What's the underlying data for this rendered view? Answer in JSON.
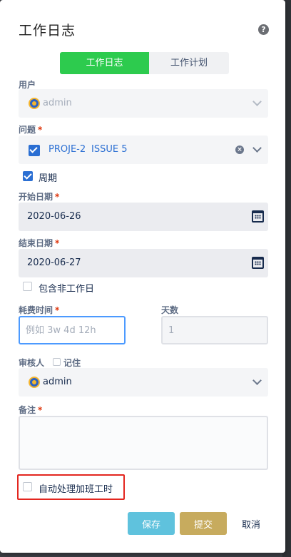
{
  "dialog": {
    "title": "工作日志",
    "help_icon": "?"
  },
  "tabs": [
    {
      "label": "工作日志",
      "active": true
    },
    {
      "label": "工作计划",
      "active": false
    }
  ],
  "user": {
    "label": "用户",
    "value": "admin"
  },
  "issue": {
    "label": "问题",
    "required_mark": "*",
    "key": "PROJE-2",
    "summary": "ISSUE 5"
  },
  "period": {
    "label": "周期",
    "checked": true
  },
  "start_date": {
    "label": "开始日期",
    "required_mark": "*",
    "value": "2020-06-26"
  },
  "end_date": {
    "label": "结束日期",
    "required_mark": "*",
    "value": "2020-06-27"
  },
  "include_non_workdays": {
    "label": "包含非工作日",
    "checked": false
  },
  "time_spent": {
    "label": "耗费时间",
    "required_mark": "*",
    "placeholder": "例如 3w 4d 12h",
    "value": ""
  },
  "days": {
    "label": "天数",
    "value": "1"
  },
  "reviewer": {
    "label": "审核人",
    "remember_label": "记住",
    "value": "admin"
  },
  "remark": {
    "label": "备注",
    "required_mark": "*",
    "value": ""
  },
  "auto_overtime": {
    "label": "自动处理加班工时",
    "checked": false
  },
  "buttons": {
    "save": "保存",
    "submit": "提交",
    "cancel": "取消"
  },
  "colors": {
    "tab_active": "#2dcb4e",
    "save_button": "#5fc2dd",
    "submit_button": "#c7ab5e",
    "highlight": "#e3261f",
    "link": "#2b6fd3"
  }
}
